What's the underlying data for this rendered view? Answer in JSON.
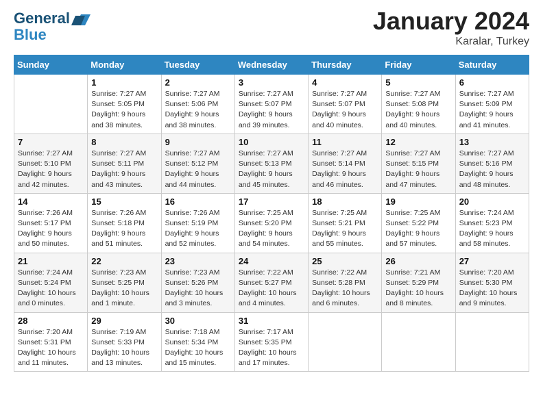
{
  "header": {
    "logo_line1": "General",
    "logo_line2": "Blue",
    "month": "January 2024",
    "location": "Karalar, Turkey"
  },
  "days_of_week": [
    "Sunday",
    "Monday",
    "Tuesday",
    "Wednesday",
    "Thursday",
    "Friday",
    "Saturday"
  ],
  "weeks": [
    [
      {
        "day": "",
        "info": ""
      },
      {
        "day": "1",
        "info": "Sunrise: 7:27 AM\nSunset: 5:05 PM\nDaylight: 9 hours\nand 38 minutes."
      },
      {
        "day": "2",
        "info": "Sunrise: 7:27 AM\nSunset: 5:06 PM\nDaylight: 9 hours\nand 38 minutes."
      },
      {
        "day": "3",
        "info": "Sunrise: 7:27 AM\nSunset: 5:07 PM\nDaylight: 9 hours\nand 39 minutes."
      },
      {
        "day": "4",
        "info": "Sunrise: 7:27 AM\nSunset: 5:07 PM\nDaylight: 9 hours\nand 40 minutes."
      },
      {
        "day": "5",
        "info": "Sunrise: 7:27 AM\nSunset: 5:08 PM\nDaylight: 9 hours\nand 40 minutes."
      },
      {
        "day": "6",
        "info": "Sunrise: 7:27 AM\nSunset: 5:09 PM\nDaylight: 9 hours\nand 41 minutes."
      }
    ],
    [
      {
        "day": "7",
        "info": "Sunrise: 7:27 AM\nSunset: 5:10 PM\nDaylight: 9 hours\nand 42 minutes."
      },
      {
        "day": "8",
        "info": "Sunrise: 7:27 AM\nSunset: 5:11 PM\nDaylight: 9 hours\nand 43 minutes."
      },
      {
        "day": "9",
        "info": "Sunrise: 7:27 AM\nSunset: 5:12 PM\nDaylight: 9 hours\nand 44 minutes."
      },
      {
        "day": "10",
        "info": "Sunrise: 7:27 AM\nSunset: 5:13 PM\nDaylight: 9 hours\nand 45 minutes."
      },
      {
        "day": "11",
        "info": "Sunrise: 7:27 AM\nSunset: 5:14 PM\nDaylight: 9 hours\nand 46 minutes."
      },
      {
        "day": "12",
        "info": "Sunrise: 7:27 AM\nSunset: 5:15 PM\nDaylight: 9 hours\nand 47 minutes."
      },
      {
        "day": "13",
        "info": "Sunrise: 7:27 AM\nSunset: 5:16 PM\nDaylight: 9 hours\nand 48 minutes."
      }
    ],
    [
      {
        "day": "14",
        "info": "Sunrise: 7:26 AM\nSunset: 5:17 PM\nDaylight: 9 hours\nand 50 minutes."
      },
      {
        "day": "15",
        "info": "Sunrise: 7:26 AM\nSunset: 5:18 PM\nDaylight: 9 hours\nand 51 minutes."
      },
      {
        "day": "16",
        "info": "Sunrise: 7:26 AM\nSunset: 5:19 PM\nDaylight: 9 hours\nand 52 minutes."
      },
      {
        "day": "17",
        "info": "Sunrise: 7:25 AM\nSunset: 5:20 PM\nDaylight: 9 hours\nand 54 minutes."
      },
      {
        "day": "18",
        "info": "Sunrise: 7:25 AM\nSunset: 5:21 PM\nDaylight: 9 hours\nand 55 minutes."
      },
      {
        "day": "19",
        "info": "Sunrise: 7:25 AM\nSunset: 5:22 PM\nDaylight: 9 hours\nand 57 minutes."
      },
      {
        "day": "20",
        "info": "Sunrise: 7:24 AM\nSunset: 5:23 PM\nDaylight: 9 hours\nand 58 minutes."
      }
    ],
    [
      {
        "day": "21",
        "info": "Sunrise: 7:24 AM\nSunset: 5:24 PM\nDaylight: 10 hours\nand 0 minutes."
      },
      {
        "day": "22",
        "info": "Sunrise: 7:23 AM\nSunset: 5:25 PM\nDaylight: 10 hours\nand 1 minute."
      },
      {
        "day": "23",
        "info": "Sunrise: 7:23 AM\nSunset: 5:26 PM\nDaylight: 10 hours\nand 3 minutes."
      },
      {
        "day": "24",
        "info": "Sunrise: 7:22 AM\nSunset: 5:27 PM\nDaylight: 10 hours\nand 4 minutes."
      },
      {
        "day": "25",
        "info": "Sunrise: 7:22 AM\nSunset: 5:28 PM\nDaylight: 10 hours\nand 6 minutes."
      },
      {
        "day": "26",
        "info": "Sunrise: 7:21 AM\nSunset: 5:29 PM\nDaylight: 10 hours\nand 8 minutes."
      },
      {
        "day": "27",
        "info": "Sunrise: 7:20 AM\nSunset: 5:30 PM\nDaylight: 10 hours\nand 9 minutes."
      }
    ],
    [
      {
        "day": "28",
        "info": "Sunrise: 7:20 AM\nSunset: 5:31 PM\nDaylight: 10 hours\nand 11 minutes."
      },
      {
        "day": "29",
        "info": "Sunrise: 7:19 AM\nSunset: 5:33 PM\nDaylight: 10 hours\nand 13 minutes."
      },
      {
        "day": "30",
        "info": "Sunrise: 7:18 AM\nSunset: 5:34 PM\nDaylight: 10 hours\nand 15 minutes."
      },
      {
        "day": "31",
        "info": "Sunrise: 7:17 AM\nSunset: 5:35 PM\nDaylight: 10 hours\nand 17 minutes."
      },
      {
        "day": "",
        "info": ""
      },
      {
        "day": "",
        "info": ""
      },
      {
        "day": "",
        "info": ""
      }
    ]
  ]
}
